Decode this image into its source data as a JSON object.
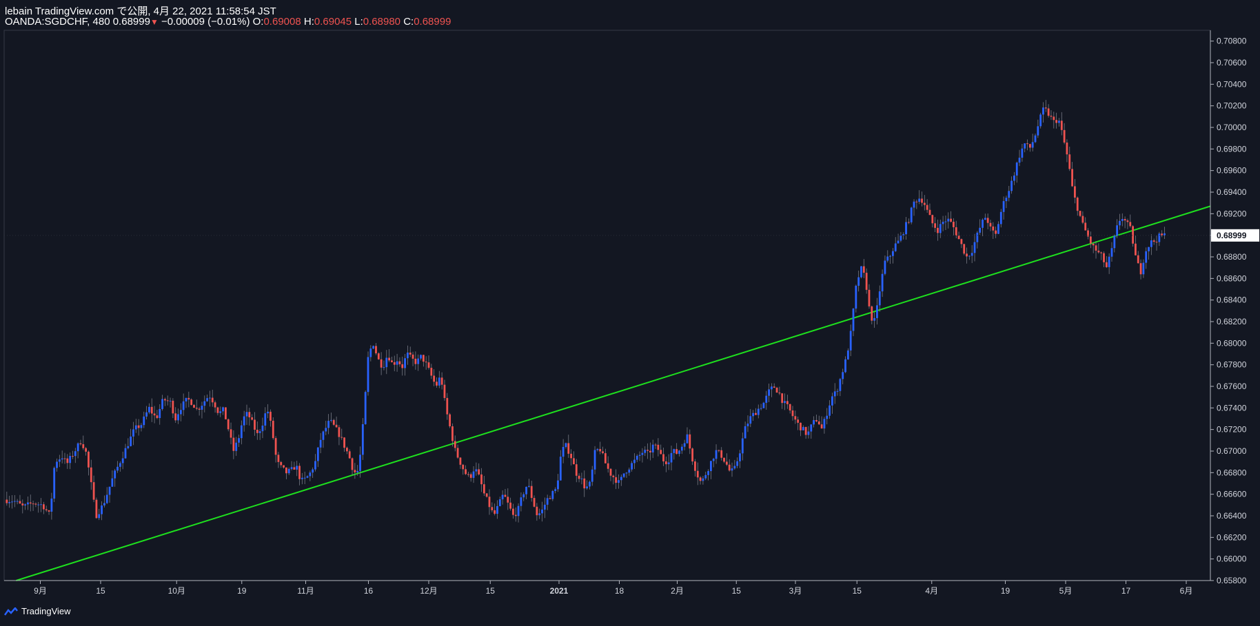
{
  "header": {
    "publish_line": "lebain TradingView.com で公開, 4月 22, 2021 11:58:54 JST",
    "symbol": "OANDA:SGDCHF, 480",
    "last": "0.68999",
    "change": "−0.00009 (−0.01%)",
    "o_label": "O:",
    "o_value": "0.69008",
    "h_label": "H:",
    "h_value": "0.69045",
    "l_label": "L:",
    "l_value": "0.68980",
    "c_label": "C:",
    "c_value": "0.68999"
  },
  "brand": {
    "name": "TradingView"
  },
  "colors": {
    "background": "#131722",
    "up": "#2962ff",
    "down": "#ef5350",
    "trendline": "#1ee01e",
    "price_tag_bg": "#ffffff"
  },
  "chart_data": {
    "type": "line",
    "ohlc_timeframe": "480",
    "ylim": [
      0.658,
      0.709
    ],
    "y_ticks": [
      "0.70800",
      "0.70600",
      "0.70400",
      "0.70200",
      "0.70000",
      "0.69800",
      "0.69600",
      "0.69400",
      "0.69200",
      "0.69000",
      "0.68800",
      "0.68600",
      "0.68400",
      "0.68200",
      "0.68000",
      "0.67800",
      "0.67600",
      "0.67400",
      "0.67200",
      "0.67000",
      "0.66800",
      "0.66600",
      "0.66400",
      "0.66200",
      "0.66000",
      "0.65800"
    ],
    "last_price_label": "0.68999",
    "x_labels": [
      "9月",
      "15",
      "10月",
      "19",
      "11月",
      "16",
      "12月",
      "15",
      "2021",
      "18",
      "2月",
      "15",
      "3月",
      "15",
      "4月",
      "19",
      "5月",
      "17",
      "6月"
    ],
    "x_label_positions": [
      0.03,
      0.08,
      0.143,
      0.197,
      0.25,
      0.302,
      0.352,
      0.403,
      0.46,
      0.51,
      0.558,
      0.607,
      0.656,
      0.707,
      0.769,
      0.83,
      0.88,
      0.93,
      0.98
    ],
    "trendline": {
      "x": [
        0.01,
        1.0
      ],
      "y": [
        0.658,
        0.6927
      ]
    },
    "series": [
      {
        "values": [
          [
            0,
            0.6655
          ],
          [
            0.008,
            0.6654
          ],
          [
            0.016,
            0.6648
          ],
          [
            0.024,
            0.6652
          ],
          [
            0.032,
            0.665
          ],
          [
            0.038,
            0.664
          ],
          [
            0.042,
            0.669
          ],
          [
            0.048,
            0.6695
          ],
          [
            0.052,
            0.6688
          ],
          [
            0.058,
            0.6699
          ],
          [
            0.064,
            0.671
          ],
          [
            0.068,
            0.6698
          ],
          [
            0.072,
            0.667
          ],
          [
            0.076,
            0.664
          ],
          [
            0.082,
            0.665
          ],
          [
            0.09,
            0.6675
          ],
          [
            0.096,
            0.669
          ],
          [
            0.102,
            0.6705
          ],
          [
            0.108,
            0.672
          ],
          [
            0.114,
            0.6725
          ],
          [
            0.12,
            0.674
          ],
          [
            0.126,
            0.673
          ],
          [
            0.132,
            0.6748
          ],
          [
            0.138,
            0.6745
          ],
          [
            0.142,
            0.673
          ],
          [
            0.146,
            0.674
          ],
          [
            0.152,
            0.6748
          ],
          [
            0.156,
            0.6745
          ],
          [
            0.16,
            0.6738
          ],
          [
            0.165,
            0.6745
          ],
          [
            0.17,
            0.6752
          ],
          [
            0.174,
            0.6745
          ],
          [
            0.178,
            0.6735
          ],
          [
            0.182,
            0.6738
          ],
          [
            0.186,
            0.672
          ],
          [
            0.19,
            0.67
          ],
          [
            0.194,
            0.671
          ],
          [
            0.198,
            0.673
          ],
          [
            0.202,
            0.6735
          ],
          [
            0.206,
            0.6725
          ],
          [
            0.21,
            0.6715
          ],
          [
            0.214,
            0.6725
          ],
          [
            0.218,
            0.674
          ],
          [
            0.222,
            0.672
          ],
          [
            0.226,
            0.669
          ],
          [
            0.23,
            0.6684
          ],
          [
            0.234,
            0.668
          ],
          [
            0.238,
            0.6682
          ],
          [
            0.242,
            0.6687
          ],
          [
            0.246,
            0.6672
          ],
          [
            0.25,
            0.6674
          ],
          [
            0.254,
            0.668
          ],
          [
            0.258,
            0.669
          ],
          [
            0.262,
            0.671
          ],
          [
            0.266,
            0.672
          ],
          [
            0.27,
            0.6728
          ],
          [
            0.274,
            0.6722
          ],
          [
            0.278,
            0.6715
          ],
          [
            0.282,
            0.6705
          ],
          [
            0.286,
            0.6695
          ],
          [
            0.29,
            0.668
          ],
          [
            0.294,
            0.6682
          ],
          [
            0.298,
            0.673
          ],
          [
            0.302,
            0.679
          ],
          [
            0.306,
            0.68
          ],
          [
            0.31,
            0.6785
          ],
          [
            0.314,
            0.6778
          ],
          [
            0.318,
            0.679
          ],
          [
            0.322,
            0.678
          ],
          [
            0.326,
            0.6785
          ],
          [
            0.33,
            0.6778
          ],
          [
            0.334,
            0.679
          ],
          [
            0.338,
            0.6785
          ],
          [
            0.342,
            0.6782
          ],
          [
            0.346,
            0.6788
          ],
          [
            0.35,
            0.678
          ],
          [
            0.354,
            0.677
          ],
          [
            0.358,
            0.676
          ],
          [
            0.362,
            0.677
          ],
          [
            0.366,
            0.674
          ],
          [
            0.37,
            0.672
          ],
          [
            0.374,
            0.67
          ],
          [
            0.378,
            0.669
          ],
          [
            0.382,
            0.668
          ],
          [
            0.386,
            0.6675
          ],
          [
            0.39,
            0.6685
          ],
          [
            0.394,
            0.6675
          ],
          [
            0.398,
            0.666
          ],
          [
            0.402,
            0.665
          ],
          [
            0.406,
            0.664
          ],
          [
            0.41,
            0.665
          ],
          [
            0.414,
            0.666
          ],
          [
            0.418,
            0.665
          ],
          [
            0.422,
            0.664
          ],
          [
            0.426,
            0.6645
          ],
          [
            0.43,
            0.666
          ],
          [
            0.434,
            0.667
          ],
          [
            0.438,
            0.6655
          ],
          [
            0.442,
            0.664
          ],
          [
            0.446,
            0.6645
          ],
          [
            0.45,
            0.6655
          ],
          [
            0.454,
            0.666
          ],
          [
            0.458,
            0.6665
          ],
          [
            0.462,
            0.67
          ],
          [
            0.466,
            0.6705
          ],
          [
            0.47,
            0.6695
          ],
          [
            0.474,
            0.668
          ],
          [
            0.478,
            0.6675
          ],
          [
            0.482,
            0.6665
          ],
          [
            0.486,
            0.667
          ],
          [
            0.49,
            0.67
          ],
          [
            0.494,
            0.6702
          ],
          [
            0.498,
            0.669
          ],
          [
            0.502,
            0.668
          ],
          [
            0.506,
            0.6675
          ],
          [
            0.51,
            0.667
          ],
          [
            0.514,
            0.668
          ],
          [
            0.518,
            0.6685
          ],
          [
            0.522,
            0.669
          ],
          [
            0.526,
            0.6695
          ],
          [
            0.53,
            0.67
          ],
          [
            0.534,
            0.6697
          ],
          [
            0.538,
            0.6705
          ],
          [
            0.542,
            0.6702
          ],
          [
            0.546,
            0.6692
          ],
          [
            0.55,
            0.669
          ],
          [
            0.554,
            0.67
          ],
          [
            0.558,
            0.6698
          ],
          [
            0.562,
            0.6705
          ],
          [
            0.566,
            0.6715
          ],
          [
            0.57,
            0.6695
          ],
          [
            0.574,
            0.668
          ],
          [
            0.578,
            0.667
          ],
          [
            0.582,
            0.668
          ],
          [
            0.586,
            0.669
          ],
          [
            0.59,
            0.67
          ],
          [
            0.594,
            0.6697
          ],
          [
            0.598,
            0.669
          ],
          [
            0.602,
            0.668
          ],
          [
            0.606,
            0.6684
          ],
          [
            0.61,
            0.67
          ],
          [
            0.614,
            0.672
          ],
          [
            0.618,
            0.673
          ],
          [
            0.622,
            0.6735
          ],
          [
            0.626,
            0.674
          ],
          [
            0.63,
            0.6745
          ],
          [
            0.634,
            0.6755
          ],
          [
            0.638,
            0.676
          ],
          [
            0.642,
            0.6755
          ],
          [
            0.646,
            0.6745
          ],
          [
            0.65,
            0.674
          ],
          [
            0.654,
            0.6732
          ],
          [
            0.658,
            0.6725
          ],
          [
            0.662,
            0.672
          ],
          [
            0.666,
            0.6715
          ],
          [
            0.67,
            0.6725
          ],
          [
            0.674,
            0.673
          ],
          [
            0.678,
            0.672
          ],
          [
            0.682,
            0.6735
          ],
          [
            0.686,
            0.675
          ],
          [
            0.69,
            0.6755
          ],
          [
            0.694,
            0.677
          ],
          [
            0.698,
            0.6785
          ],
          [
            0.702,
            0.681
          ],
          [
            0.706,
            0.685
          ],
          [
            0.71,
            0.687
          ],
          [
            0.714,
            0.686
          ],
          [
            0.718,
            0.6825
          ],
          [
            0.722,
            0.682
          ],
          [
            0.726,
            0.685
          ],
          [
            0.73,
            0.6875
          ],
          [
            0.734,
            0.688
          ],
          [
            0.738,
            0.689
          ],
          [
            0.742,
            0.6895
          ],
          [
            0.746,
            0.6905
          ],
          [
            0.75,
            0.6915
          ],
          [
            0.754,
            0.693
          ],
          [
            0.758,
            0.6935
          ],
          [
            0.762,
            0.6932
          ],
          [
            0.766,
            0.692
          ],
          [
            0.77,
            0.691
          ],
          [
            0.774,
            0.6905
          ],
          [
            0.778,
            0.6912
          ],
          [
            0.782,
            0.6915
          ],
          [
            0.786,
            0.691
          ],
          [
            0.79,
            0.69
          ],
          [
            0.794,
            0.689
          ],
          [
            0.798,
            0.688
          ],
          [
            0.802,
            0.6885
          ],
          [
            0.806,
            0.6898
          ],
          [
            0.81,
            0.691
          ],
          [
            0.814,
            0.6918
          ],
          [
            0.818,
            0.6905
          ],
          [
            0.822,
            0.69
          ],
          [
            0.826,
            0.692
          ],
          [
            0.83,
            0.6935
          ],
          [
            0.834,
            0.6945
          ],
          [
            0.838,
            0.696
          ],
          [
            0.842,
            0.6975
          ],
          [
            0.846,
            0.6985
          ],
          [
            0.85,
            0.698
          ],
          [
            0.854,
            0.699
          ],
          [
            0.858,
            0.7005
          ],
          [
            0.862,
            0.7018
          ],
          [
            0.866,
            0.7012
          ],
          [
            0.87,
            0.7005
          ],
          [
            0.874,
            0.7008
          ],
          [
            0.878,
            0.699
          ],
          [
            0.882,
            0.697
          ],
          [
            0.886,
            0.694
          ],
          [
            0.89,
            0.6925
          ],
          [
            0.894,
            0.691
          ],
          [
            0.898,
            0.69
          ],
          [
            0.902,
            0.689
          ],
          [
            0.906,
            0.6885
          ],
          [
            0.91,
            0.688
          ],
          [
            0.914,
            0.687
          ],
          [
            0.918,
            0.6885
          ],
          [
            0.922,
            0.6905
          ],
          [
            0.926,
            0.6918
          ],
          [
            0.93,
            0.6912
          ],
          [
            0.934,
            0.6905
          ],
          [
            0.938,
            0.688
          ],
          [
            0.942,
            0.6865
          ],
          [
            0.946,
            0.6885
          ],
          [
            0.95,
            0.6893
          ],
          [
            0.954,
            0.6895
          ],
          [
            0.958,
            0.6899
          ],
          [
            0.962,
            0.69
          ]
        ]
      }
    ]
  }
}
